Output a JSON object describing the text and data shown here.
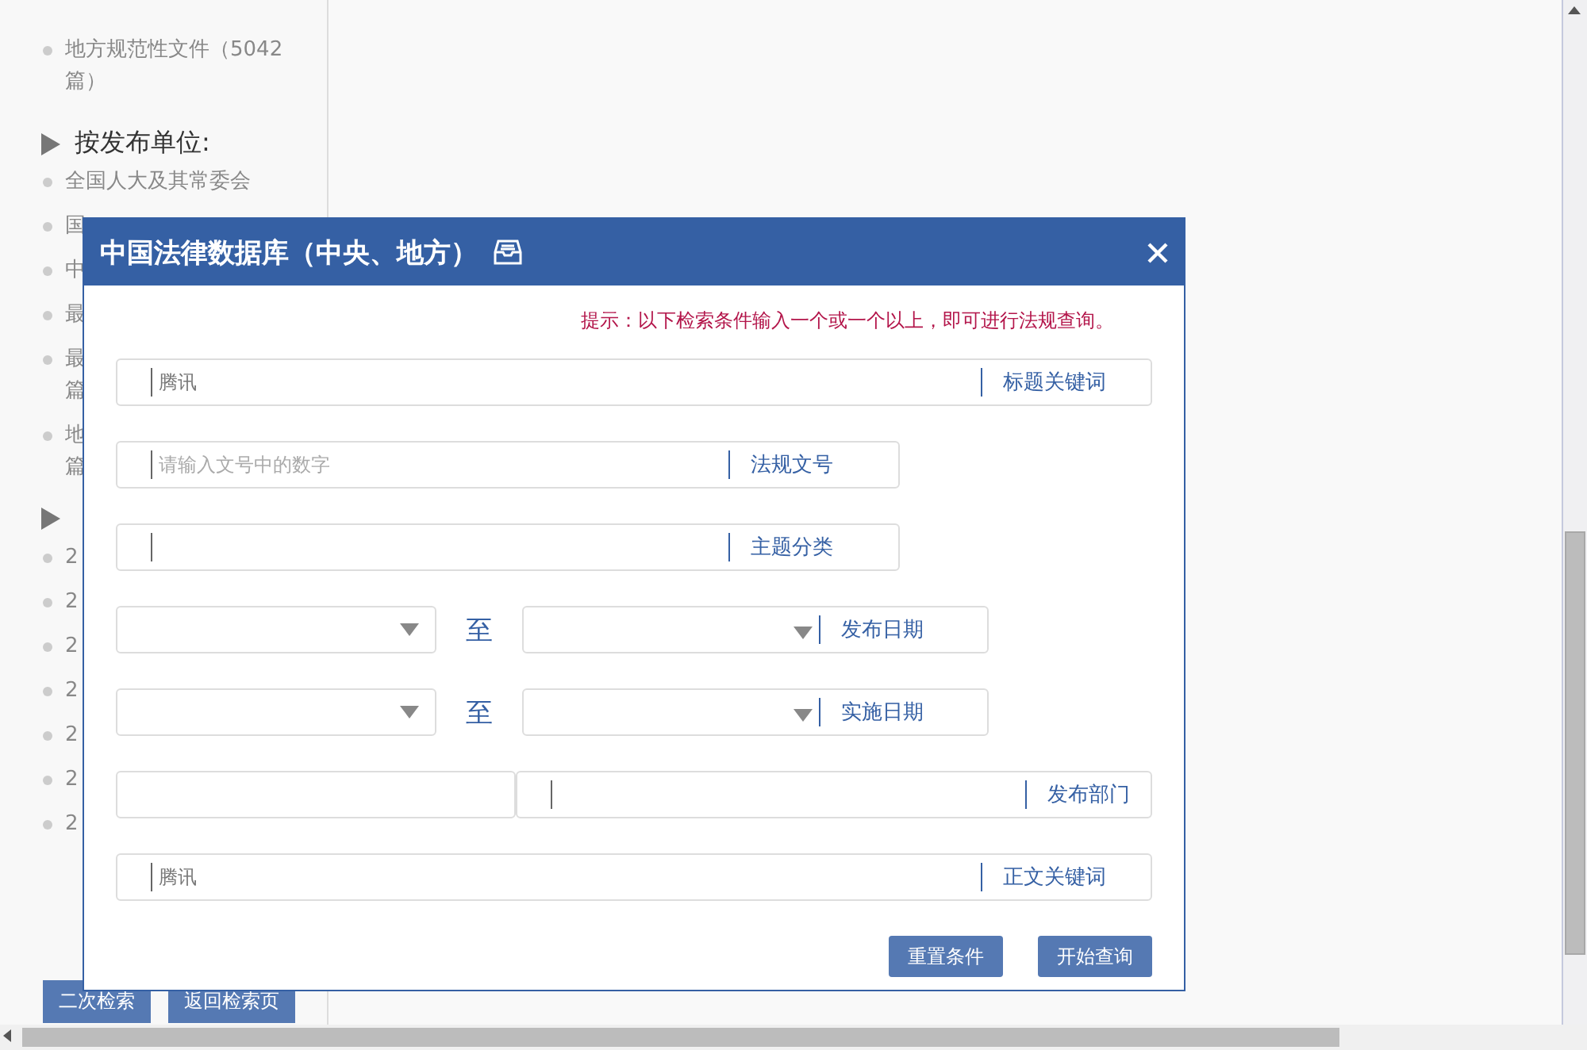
{
  "sidebar": {
    "sections": [
      {
        "items": [
          {
            "lines": [
              "地方规范性文件（5042",
              "篇）"
            ]
          }
        ]
      },
      {
        "header": "按发布单位:",
        "items": [
          {
            "lines": [
              "全国人大及其常委会"
            ]
          },
          {
            "lines": [
              "国"
            ]
          },
          {
            "lines": [
              "中"
            ]
          },
          {
            "lines": [
              "最"
            ]
          },
          {
            "lines": [
              "最",
              "篇"
            ]
          },
          {
            "lines": [
              "地",
              "篇"
            ]
          }
        ]
      },
      {
        "items": [
          {
            "lines": [
              "2"
            ]
          },
          {
            "lines": [
              "2"
            ]
          },
          {
            "lines": [
              "2"
            ]
          },
          {
            "lines": [
              "2"
            ]
          },
          {
            "lines": [
              "2"
            ]
          },
          {
            "lines": [
              "2"
            ]
          },
          {
            "lines": [
              "2"
            ]
          }
        ]
      }
    ],
    "buttons": [
      "二次检索",
      "返回检索页"
    ]
  },
  "dialog": {
    "title": "中国法律数据库（中央、地方）",
    "hint": "提示：以下检索条件输入一个或一个以上，即可进行法规查询。",
    "fields": [
      {
        "kind": "wide",
        "value": "腾讯",
        "label": "标题关键词"
      },
      {
        "kind": "narrow",
        "placeholder": "请输入文号中的数字",
        "label": "法规文号"
      },
      {
        "kind": "narrow",
        "label": "主题分类"
      },
      {
        "kind": "range",
        "separator": "至",
        "label": "发布日期"
      },
      {
        "kind": "range",
        "separator": "至",
        "label": "实施日期"
      },
      {
        "kind": "split",
        "label": "发布部门"
      },
      {
        "kind": "wide",
        "value": "腾讯",
        "label": "正文关键词"
      }
    ],
    "buttons": [
      "重置条件",
      "开始查询"
    ]
  }
}
